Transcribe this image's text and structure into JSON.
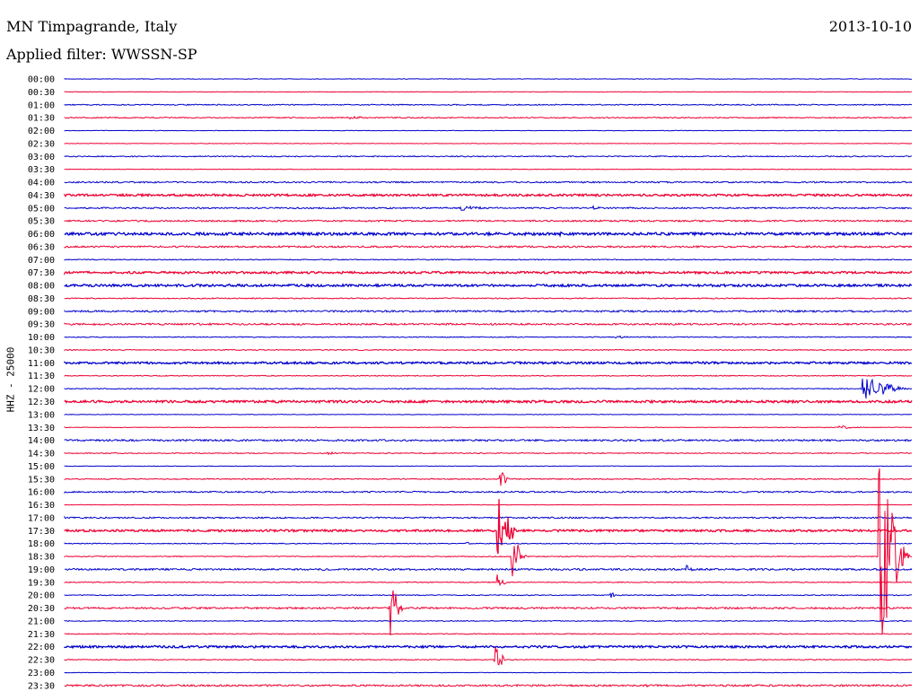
{
  "header": {
    "station": "MN Timpagrande, Italy",
    "date": "2013-10-10",
    "filter": "Applied filter: WWSSN-SP"
  },
  "channel_label": "HHZ - 25000",
  "chart_data": {
    "type": "helicorder",
    "title": "MN Timpagrande, Italy",
    "date": "2013-10-10",
    "filter": "WWSSN-SP",
    "channel": "HHZ",
    "scale": 25000,
    "colors": {
      "even_row": "#0000cc",
      "odd_row": "#ee0033"
    },
    "row_minutes": 30,
    "rows": [
      "00:00",
      "00:30",
      "01:00",
      "01:30",
      "02:00",
      "02:30",
      "03:00",
      "03:30",
      "04:00",
      "04:30",
      "05:00",
      "05:30",
      "06:00",
      "06:30",
      "07:00",
      "07:30",
      "08:00",
      "08:30",
      "09:00",
      "09:30",
      "10:00",
      "10:30",
      "11:00",
      "11:30",
      "12:00",
      "12:30",
      "13:00",
      "13:30",
      "14:00",
      "14:30",
      "15:00",
      "15:30",
      "16:00",
      "16:30",
      "17:00",
      "17:30",
      "18:00",
      "18:30",
      "19:00",
      "19:30",
      "20:00",
      "20:30",
      "21:00",
      "21:30",
      "22:00",
      "22:30",
      "23:00",
      "23:30"
    ],
    "noise_levels": [
      0.3,
      0.3,
      0.6,
      0.6,
      0.3,
      0.3,
      0.6,
      0.3,
      0.8,
      1.2,
      0.8,
      0.9,
      1.5,
      1.0,
      0.5,
      1.2,
      1.3,
      0.6,
      1.0,
      1.0,
      0.5,
      0.5,
      1.2,
      0.5,
      0.5,
      1.3,
      0.3,
      0.3,
      1.0,
      0.5,
      0.3,
      0.6,
      0.8,
      0.3,
      0.8,
      1.2,
      0.5,
      0.5,
      1.0,
      0.5,
      0.5,
      1.0,
      0.5,
      0.5,
      1.2,
      0.5,
      0.3,
      1.0
    ],
    "events": [
      {
        "row": "01:30",
        "minute": 10.0,
        "amp": 2,
        "dur": 1.2
      },
      {
        "row": "05:00",
        "minute": 14.0,
        "amp": 3,
        "dur": 1.5
      },
      {
        "row": "05:00",
        "minute": 18.7,
        "amp": 2,
        "dur": 0.5
      },
      {
        "row": "06:00",
        "minute": 17.4,
        "amp": 3,
        "dur": 0.5
      },
      {
        "row": "07:30",
        "minute": 5.3,
        "amp": 2,
        "dur": 0.5
      },
      {
        "row": "10:00",
        "minute": 19.5,
        "amp": 2,
        "dur": 0.6
      },
      {
        "row": "12:00",
        "minute": 28.2,
        "amp": 16,
        "dur": 1.8
      },
      {
        "row": "13:30",
        "minute": 27.4,
        "amp": 2,
        "dur": 1.0
      },
      {
        "row": "14:30",
        "minute": 9.3,
        "amp": 3,
        "dur": 0.4
      },
      {
        "row": "15:30",
        "minute": 15.4,
        "amp": 12,
        "dur": 0.4
      },
      {
        "row": "17:30",
        "minute": 15.3,
        "amp": 40,
        "dur": 0.9
      },
      {
        "row": "18:00",
        "minute": 14.2,
        "amp": 3,
        "dur": 0.3
      },
      {
        "row": "18:30",
        "minute": 15.8,
        "amp": 30,
        "dur": 0.6
      },
      {
        "row": "19:00",
        "minute": 22.0,
        "amp": 6,
        "dur": 0.3
      },
      {
        "row": "19:30",
        "minute": 15.3,
        "amp": 12,
        "dur": 0.4
      },
      {
        "row": "20:00",
        "minute": 19.3,
        "amp": 6,
        "dur": 0.3
      },
      {
        "row": "20:30",
        "minute": 11.5,
        "amp": 35,
        "dur": 0.6
      },
      {
        "row": "22:30",
        "minute": 15.2,
        "amp": 20,
        "dur": 0.5
      },
      {
        "row": "18:30",
        "minute": 28.8,
        "amp": 110,
        "dur": 1.2
      },
      {
        "row": "23:30",
        "minute": 20.5,
        "amp": 2,
        "dur": 0.3
      }
    ]
  }
}
